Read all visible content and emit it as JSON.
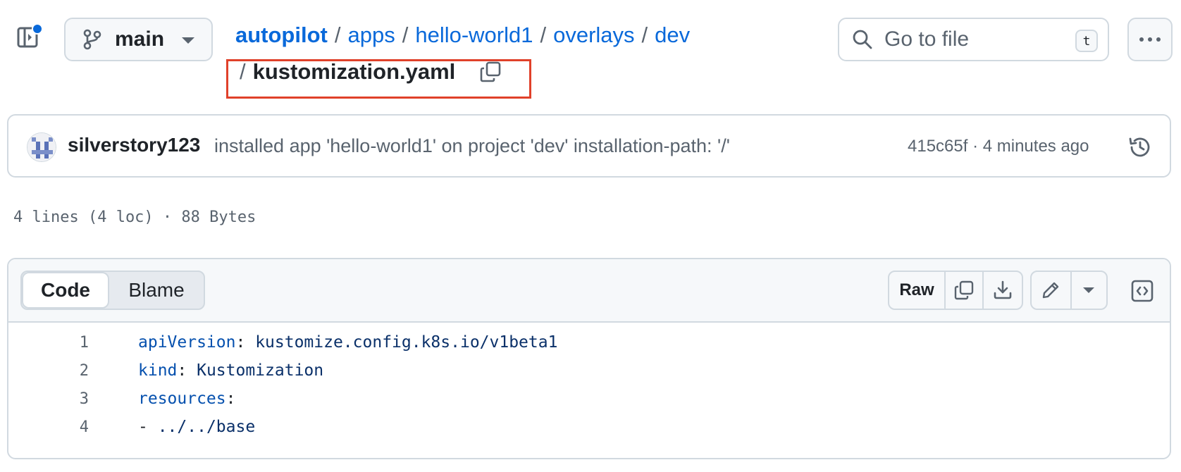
{
  "header": {
    "branch": "main",
    "breadcrumb": {
      "repo": "autopilot",
      "segments": [
        "apps",
        "hello-world1",
        "overlays",
        "dev"
      ],
      "separator": "/",
      "file": "kustomization.yaml"
    },
    "search": {
      "placeholder": "Go to file",
      "shortcut": "t"
    }
  },
  "commit": {
    "author": "silverstory123",
    "message": "installed app 'hello-world1' on project 'dev' installation-path: '/'",
    "meta": "415c65f · 4 minutes ago"
  },
  "file_info": "4 lines (4 loc) · 88 Bytes",
  "code_view": {
    "tabs": [
      "Code",
      "Blame"
    ],
    "active_tab": "Code",
    "raw_label": "Raw",
    "lines": [
      {
        "n": "1",
        "key": "apiVersion",
        "sep": ": ",
        "val": "kustomize.config.k8s.io/v1beta1"
      },
      {
        "n": "2",
        "key": "kind",
        "sep": ": ",
        "val": "Kustomization"
      },
      {
        "n": "3",
        "key": "resources",
        "sep": ":",
        "val": ""
      },
      {
        "n": "4",
        "key": "",
        "sep": "- ",
        "val": "../../base"
      }
    ]
  },
  "colors": {
    "link": "#0969da",
    "highlight_box": "#e0412a",
    "notification_dot": "#0969da",
    "yaml_key": "#0550ae",
    "yaml_value": "#0a3069"
  },
  "icons": [
    "sidebar-toggle-icon",
    "git-branch-icon",
    "caret-down-icon",
    "copy-icon",
    "search-icon",
    "kebab-horizontal-icon",
    "history-icon",
    "download-icon",
    "pencil-icon",
    "code-square-icon"
  ]
}
